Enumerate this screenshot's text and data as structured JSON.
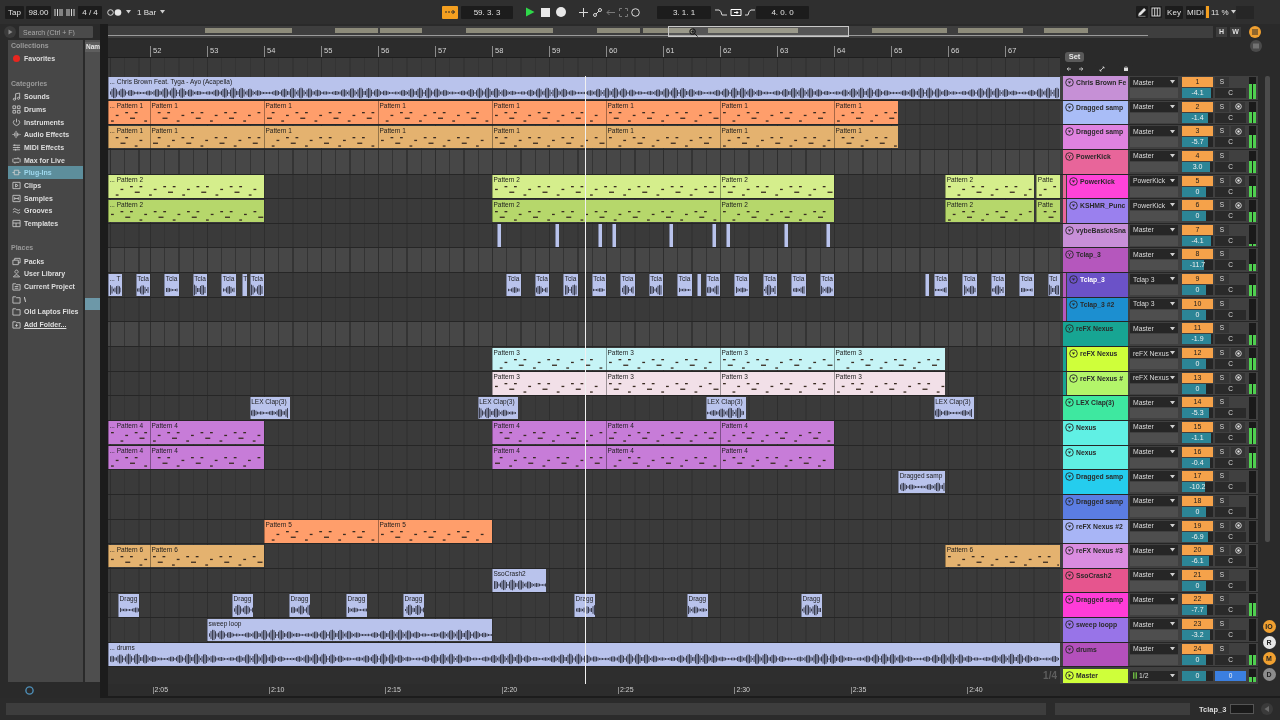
{
  "toolbar": {
    "tap": "Tap",
    "tempo": "98.00",
    "signature": "4 / 4",
    "quantization": "1 Bar",
    "follow": true,
    "position": "59. 3. 3",
    "playing": true,
    "recording": false,
    "loop_start": "3. 1. 1",
    "loop": true,
    "loop_length": "4. 0. 0",
    "key_map": "Key",
    "midi_map": "MIDI",
    "cpu": "11 %"
  },
  "browser": {
    "search": {
      "placeholder": "Search (Ctrl + F)"
    },
    "sections": [
      {
        "title": "Collections",
        "items": [
          {
            "label": "Favorites",
            "selected": false,
            "color": "#e8261f"
          }
        ]
      },
      {
        "title": "Categories",
        "items": [
          {
            "label": "Sounds",
            "selected": false
          },
          {
            "label": "Drums",
            "selected": false
          },
          {
            "label": "Instruments",
            "selected": false
          },
          {
            "label": "Audio Effects",
            "selected": false
          },
          {
            "label": "MIDI Effects",
            "selected": false
          },
          {
            "label": "Max for Live",
            "selected": false
          },
          {
            "label": "Plug-Ins",
            "selected": true
          },
          {
            "label": "Clips",
            "selected": false
          },
          {
            "label": "Samples",
            "selected": false
          },
          {
            "label": "Grooves",
            "selected": false
          },
          {
            "label": "Templates",
            "selected": false
          }
        ]
      },
      {
        "title": "Places",
        "items": [
          {
            "label": "Packs",
            "selected": false
          },
          {
            "label": "User Library",
            "selected": false
          },
          {
            "label": "Current Project",
            "selected": false
          },
          {
            "label": "\\",
            "selected": false
          },
          {
            "label": "Old Laptos Files",
            "selected": false
          }
        ],
        "add_folder": "Add Folder..."
      }
    ],
    "file_list": {
      "column_header": "Nam",
      "highlight": true
    }
  },
  "view_buttons": [
    "H",
    "W"
  ],
  "arrangement": {
    "bars": [
      "52",
      "53",
      "54",
      "55",
      "56",
      "57",
      "58",
      "59",
      "60",
      "61",
      "62",
      "63",
      "64",
      "65",
      "66",
      "67"
    ],
    "times": [
      "2:05",
      "2:10",
      "2:15",
      "2:20",
      "2:25",
      "2:30",
      "2:35",
      "2:40"
    ],
    "set_label": "Set",
    "grid_label": "1/4",
    "tracks": [
      {
        "name": "Chris Brown Fe",
        "color": "#c690d6",
        "kind": "audio",
        "selected": false,
        "routing": "Master",
        "number": "1",
        "solo": "S",
        "arm_button": false,
        "volume": {
          "value": "-4.1",
          "level": 0.95
        },
        "pan": "C",
        "meter": {
          "level": 0.7
        },
        "clips": [
          {
            "name": "... Chris Brown Feat. Tyga - Ayo (Acapella)",
            "color": "#b9c3ec"
          }
        ]
      },
      {
        "name": "Dragged samp",
        "color": "#a9bdf7",
        "kind": "midi",
        "selected": false,
        "routing": "Master",
        "number": "2",
        "solo": "S",
        "arm_button": true,
        "volume": {
          "value": "-1.4",
          "level": 0.85
        },
        "pan": "C",
        "meter": {
          "level": 0.5
        },
        "clips": [
          {
            "name": "... Pattern 1",
            "color": "#ff9e6b"
          },
          {
            "name": "Pattern 1",
            "color": "#ff9e6b"
          },
          {
            "name": "Pattern 1",
            "color": "#ff9e6b"
          },
          {
            "name": "Pattern 1",
            "color": "#ff9e6b"
          },
          {
            "name": "Pattern 1",
            "color": "#ff9e6b"
          },
          {
            "name": "Pattern 1",
            "color": "#ff9e6b"
          },
          {
            "name": "Pattern 1",
            "color": "#ff9e6b"
          },
          {
            "name": "Pattern 1",
            "color": "#ff9e6b"
          }
        ]
      },
      {
        "name": "Dragged samp",
        "color": "#df82e0",
        "kind": "midi",
        "selected": false,
        "routing": "Master",
        "number": "3",
        "solo": "S",
        "arm_button": true,
        "volume": {
          "value": "-5.7",
          "level": 0.85
        },
        "pan": "C",
        "meter": {
          "level": 0.6
        },
        "clips": [
          {
            "name": "... Pattern 1",
            "color": "#e4b26f"
          },
          {
            "name": "Pattern 1",
            "color": "#e4b26f"
          },
          {
            "name": "Pattern 1",
            "color": "#e4b26f"
          },
          {
            "name": "Pattern 1",
            "color": "#e4b26f"
          },
          {
            "name": "Pattern 1",
            "color": "#e4b26f"
          },
          {
            "name": "Pattern 1",
            "color": "#e4b26f"
          },
          {
            "name": "Pattern 1",
            "color": "#e4b26f"
          },
          {
            "name": "Pattern 1",
            "color": "#e4b26f"
          }
        ]
      },
      {
        "name": "PowerKick",
        "color": "#e8659a",
        "kind": "group",
        "selected": false,
        "routing": "Master",
        "number": "4",
        "solo": "S",
        "arm_button": false,
        "volume": {
          "value": "3.0",
          "level": 0.9
        },
        "pan": "C",
        "meter": {
          "level": 0.55
        },
        "children": [
          {
            "name": "PowerKick",
            "color": "#ff43d9",
            "kind": "midi",
            "selected": false,
            "routing": "PowerKick",
            "number": "5",
            "solo": "S",
            "arm_button": true,
            "volume": {
              "value": "0",
              "level": 0.78
            },
            "pan": "C",
            "meter": {
              "level": 0.5
            },
            "clips": [
              {
                "name": "... Pattern 2",
                "color": "#d5ee8c"
              },
              {
                "name": "Pattern 2",
                "color": "#d5ee8c"
              },
              {
                "name": "Pattern 2",
                "color": "#d5ee8c"
              },
              {
                "name": "Pattern 2",
                "color": "#d5ee8c"
              },
              {
                "name": "Patte",
                "color": "#d5ee8c"
              }
            ]
          },
          {
            "name": "KSHMR_Punc",
            "color": "#9a80ee",
            "kind": "midi",
            "selected": false,
            "routing": "PowerKick",
            "number": "6",
            "solo": "S",
            "arm_button": true,
            "volume": {
              "value": "0",
              "level": 0.78
            },
            "pan": "C",
            "meter": {
              "level": 0.45
            },
            "clips": [
              {
                "name": "... Pattern 2",
                "color": "#b6d76b"
              },
              {
                "name": "Pattern 2",
                "color": "#b6d76b"
              },
              {
                "name": "Pattern 2",
                "color": "#b6d76b"
              },
              {
                "name": "Pattern 2",
                "color": "#b6d76b"
              },
              {
                "name": "Patte",
                "color": "#b6d76b"
              }
            ]
          }
        ]
      },
      {
        "name": "vybeBasickSna",
        "color": "#c88fd8",
        "kind": "audio",
        "selected": false,
        "routing": "Master",
        "number": "7",
        "solo": "S",
        "arm_button": false,
        "volume": {
          "value": "-4.1",
          "level": 0.95
        },
        "pan": "C",
        "meter": {
          "level": 0.12
        },
        "clips": [
          {
            "color": "#b9c3ec"
          },
          {
            "color": "#b9c3ec"
          },
          {
            "color": "#b9c3ec"
          },
          {
            "color": "#b9c3ec"
          },
          {
            "color": "#b9c3ec"
          },
          {
            "color": "#b9c3ec"
          },
          {
            "color": "#b9c3ec"
          },
          {
            "color": "#b9c3ec"
          },
          {
            "color": "#b9c3ec"
          }
        ]
      },
      {
        "name": "Tclap_3",
        "color": "#b557bd",
        "kind": "group",
        "selected": false,
        "routing": "Master",
        "number": "8",
        "solo": "S",
        "arm_button": false,
        "volume": {
          "value": "-11.7",
          "level": 0.7
        },
        "pan": "C",
        "meter": {
          "level": 0.35
        },
        "children": [
          {
            "name": "Tclap_3",
            "color": "#6b52c8",
            "kind": "audio",
            "selected": true,
            "routing": "Tclap 3",
            "number": "9",
            "solo": "S",
            "arm_button": false,
            "volume": {
              "value": "0",
              "level": 0.78
            },
            "pan": "C",
            "meter": {
              "level": 0.5
            },
            "clips": [
              {
                "name": "... T",
                "color": "#b9c3ec"
              },
              {
                "name": "Tcla",
                "color": "#b9c3ec"
              },
              {
                "name": "Tcla",
                "color": "#b9c3ec"
              },
              {
                "name": "Tcla",
                "color": "#b9c3ec"
              },
              {
                "name": "Tcla",
                "color": "#b9c3ec"
              },
              {
                "name": "T",
                "color": "#b9c3ec"
              },
              {
                "name": "Tcla",
                "color": "#b9c3ec"
              },
              {
                "name": "Tcla",
                "color": "#b9c3ec"
              },
              {
                "name": "Tcla",
                "color": "#b9c3ec"
              },
              {
                "name": "Tcla",
                "color": "#b9c3ec"
              },
              {
                "name": "Tcla",
                "color": "#b9c3ec"
              },
              {
                "name": "Tcla",
                "color": "#b9c3ec"
              },
              {
                "name": "Tcla",
                "color": "#b9c3ec"
              },
              {
                "name": "Tcla",
                "color": "#b9c3ec"
              },
              {
                "color": "#b9c3ec"
              },
              {
                "name": "Tcla",
                "color": "#b9c3ec"
              },
              {
                "name": "Tcla",
                "color": "#b9c3ec"
              },
              {
                "name": "Tcla",
                "color": "#b9c3ec"
              },
              {
                "name": "Tcla",
                "color": "#b9c3ec"
              },
              {
                "name": "Tcla",
                "color": "#b9c3ec"
              },
              {
                "color": "#b9c3ec"
              },
              {
                "name": "Tcla",
                "color": "#b9c3ec"
              },
              {
                "name": "Tcla",
                "color": "#b9c3ec"
              },
              {
                "name": "Tcla",
                "color": "#b9c3ec"
              },
              {
                "name": "Tcla",
                "color": "#b9c3ec"
              },
              {
                "name": "Tcl",
                "color": "#b9c3ec"
              }
            ]
          },
          {
            "name": "Tclap_3 #2",
            "color": "#1c8fd0",
            "kind": "audio",
            "selected": false,
            "routing": "Tclap 3",
            "number": "10",
            "solo": "S",
            "arm_button": false,
            "volume": {
              "value": "0",
              "level": 0.78
            },
            "pan": "C",
            "meter": {
              "level": 0
            }
          }
        ]
      },
      {
        "name": "reFX Nexus",
        "color": "#17a593",
        "kind": "group",
        "selected": false,
        "routing": "Master",
        "number": "11",
        "solo": "S",
        "arm_button": false,
        "volume": {
          "value": "-1.9",
          "level": 0.93
        },
        "pan": "C",
        "meter": {
          "level": 0.45
        },
        "children": [
          {
            "name": "reFX Nexus",
            "color": "#cfff3a",
            "kind": "midi",
            "selected": false,
            "routing": "reFX Nexus",
            "number": "12",
            "solo": "S",
            "arm_button": true,
            "volume": {
              "value": "0",
              "level": 0.78
            },
            "pan": "C",
            "meter": {
              "level": 0.55
            },
            "clips": [
              {
                "name": "Pattern 3",
                "color": "#c6f4f6"
              },
              {
                "name": "Pattern 3",
                "color": "#c6f4f6"
              },
              {
                "name": "Pattern 3",
                "color": "#c6f4f6"
              },
              {
                "name": "Pattern 3",
                "color": "#c6f4f6"
              }
            ]
          },
          {
            "name": "reFX Nexus #",
            "color": "#b3f56a",
            "kind": "midi",
            "selected": false,
            "routing": "reFX Nexus",
            "number": "13",
            "solo": "S",
            "arm_button": true,
            "volume": {
              "value": "0",
              "level": 0.78
            },
            "pan": "C",
            "meter": {
              "level": 0.5
            },
            "clips": [
              {
                "name": "Pattern 3",
                "color": "#f2e0e8"
              },
              {
                "name": "Pattern 3",
                "color": "#f2e0e8"
              },
              {
                "name": "Pattern 3",
                "color": "#f2e0e8"
              },
              {
                "name": "Pattern 3",
                "color": "#f2e0e8"
              }
            ]
          }
        ]
      },
      {
        "name": "LEX Clap(3)",
        "color": "#3ee8a0",
        "kind": "audio",
        "selected": false,
        "routing": "Master",
        "number": "14",
        "solo": "S",
        "arm_button": false,
        "volume": {
          "value": "-5.3",
          "level": 0.88
        },
        "pan": "C",
        "meter": {
          "level": 0
        },
        "clips": [
          {
            "name": "LEX Clap(3)",
            "color": "#b9c3ec"
          },
          {
            "name": "LEX Clap(3)",
            "color": "#b9c3ec"
          },
          {
            "name": "LEX Clap(3)",
            "color": "#b9c3ec"
          },
          {
            "name": "LEX Clap(3)",
            "color": "#b9c3ec"
          }
        ]
      },
      {
        "name": "Nexus",
        "color": "#60f0e4",
        "kind": "midi",
        "selected": false,
        "routing": "Master",
        "number": "15",
        "solo": "S",
        "arm_button": true,
        "volume": {
          "value": "-1.1",
          "level": 0.92
        },
        "pan": "C",
        "meter": {
          "level": 0.7
        },
        "clips": [
          {
            "name": "... Pattern 4",
            "color": "#c77cd8"
          },
          {
            "name": "Pattern 4",
            "color": "#c77cd8"
          },
          {
            "name": "Pattern 4",
            "color": "#c77cd8"
          },
          {
            "name": "Pattern 4",
            "color": "#c77cd8"
          },
          {
            "name": "Pattern 4",
            "color": "#c77cd8"
          }
        ]
      },
      {
        "name": "Nexus",
        "color": "#60f0e4",
        "kind": "midi",
        "selected": false,
        "routing": "Master",
        "number": "16",
        "solo": "S",
        "arm_button": true,
        "volume": {
          "value": "-0.4",
          "level": 0.9
        },
        "pan": "C",
        "meter": {
          "level": 0.7
        },
        "clips": [
          {
            "name": "... Pattern 4",
            "color": "#c77cd8"
          },
          {
            "name": "Pattern 4",
            "color": "#c77cd8"
          },
          {
            "name": "Pattern 4",
            "color": "#c77cd8"
          },
          {
            "name": "Pattern 4",
            "color": "#c77cd8"
          },
          {
            "name": "Pattern 4",
            "color": "#c77cd8"
          }
        ]
      },
      {
        "name": "Dragged samp",
        "color": "#25cdee",
        "kind": "audio",
        "selected": false,
        "routing": "Master",
        "number": "17",
        "solo": "S",
        "arm_button": false,
        "volume": {
          "value": "-10.2",
          "level": 0.75
        },
        "pan": "C",
        "meter": {
          "level": 0
        },
        "clips": [
          {
            "name": "Dragged samp",
            "color": "#b9c3ec"
          }
        ]
      },
      {
        "name": "Dragged samp",
        "color": "#5b7de2",
        "kind": "audio",
        "selected": false,
        "routing": "Master",
        "number": "18",
        "solo": "S",
        "arm_button": false,
        "volume": {
          "value": "0",
          "level": 0.78
        },
        "pan": "C",
        "meter": {
          "level": 0
        }
      },
      {
        "name": "reFX Nexus #2",
        "color": "#a8b5f6",
        "kind": "midi",
        "selected": false,
        "routing": "Master",
        "number": "19",
        "solo": "S",
        "arm_button": true,
        "volume": {
          "value": "-6.9",
          "level": 0.85
        },
        "pan": "C",
        "meter": {
          "level": 0
        },
        "clips": [
          {
            "name": "Pattern 5",
            "color": "#ff9e6b"
          },
          {
            "name": "Pattern 5",
            "color": "#ff9e6b"
          }
        ]
      },
      {
        "name": "reFX Nexus #3",
        "color": "#da8ce0",
        "kind": "midi",
        "selected": false,
        "routing": "Master",
        "number": "20",
        "solo": "S",
        "arm_button": true,
        "volume": {
          "value": "-6.1",
          "level": 0.86
        },
        "pan": "C",
        "meter": {
          "level": 0
        },
        "clips": [
          {
            "name": "... Pattern 6",
            "color": "#e4b26f"
          },
          {
            "name": "Pattern 6",
            "color": "#e4b26f"
          },
          {
            "name": "Pattern 6",
            "color": "#e4b26f"
          }
        ]
      },
      {
        "name": "SsoCrash2",
        "color": "#e6558e",
        "kind": "audio",
        "selected": false,
        "routing": "Master",
        "number": "21",
        "solo": "S",
        "arm_button": false,
        "volume": {
          "value": "0",
          "level": 0.78
        },
        "pan": "C",
        "meter": {
          "level": 0
        },
        "clips": [
          {
            "name": "SsoCrash2",
            "color": "#b9c3ec"
          }
        ]
      },
      {
        "name": "Dragged samp",
        "color": "#ff3cd8",
        "kind": "audio",
        "selected": false,
        "routing": "Master",
        "number": "22",
        "solo": "S",
        "arm_button": false,
        "volume": {
          "value": "-7.7",
          "level": 0.82
        },
        "pan": "C",
        "meter": {
          "level": 0.6
        },
        "clips": [
          {
            "name": "Dragg",
            "color": "#b9c3ec"
          },
          {
            "name": "Dragg",
            "color": "#b9c3ec"
          },
          {
            "name": "Dragg",
            "color": "#b9c3ec"
          },
          {
            "name": "Dragg",
            "color": "#b9c3ec"
          },
          {
            "name": "Dragg",
            "color": "#b9c3ec"
          },
          {
            "name": "Dragg",
            "color": "#b9c3ec"
          },
          {
            "name": "Dragg",
            "color": "#b9c3ec"
          },
          {
            "name": "Dragg",
            "color": "#b9c3ec"
          }
        ]
      },
      {
        "name": "sweep loopp",
        "color": "#9874e8",
        "kind": "audio",
        "selected": false,
        "routing": "Master",
        "number": "23",
        "solo": "S",
        "arm_button": false,
        "volume": {
          "value": "-3.2",
          "level": 0.9
        },
        "pan": "C",
        "meter": {
          "level": 0
        },
        "clips": [
          {
            "name": "sweep loop",
            "color": "#b9c3ec"
          }
        ]
      },
      {
        "name": "drums",
        "color": "#b450bc",
        "kind": "audio",
        "selected": false,
        "routing": "Master",
        "number": "24",
        "solo": "S",
        "arm_button": false,
        "volume": {
          "value": "0",
          "level": 0.78
        },
        "pan": "C",
        "meter": {
          "level": 0.5
        },
        "clips": [
          {
            "name": "... drums",
            "color": "#b9c3ec"
          }
        ]
      }
    ],
    "master": {
      "name": "Master",
      "color": "#cfff3a",
      "routing": "1/2",
      "volume": {
        "value": "0",
        "level": 0.78
      },
      "pan": "0",
      "meter": {
        "level": 0.4
      }
    }
  },
  "mixer_toggles": [
    {
      "label": "IO",
      "color": "#f0a030"
    },
    {
      "label": "R",
      "color": "#e6e6e6"
    },
    {
      "label": "M",
      "color": "#f0a030"
    },
    {
      "label": "D",
      "color": "#8c8c8c"
    }
  ],
  "status_bar": {
    "selected_track": "Tclap_3"
  }
}
